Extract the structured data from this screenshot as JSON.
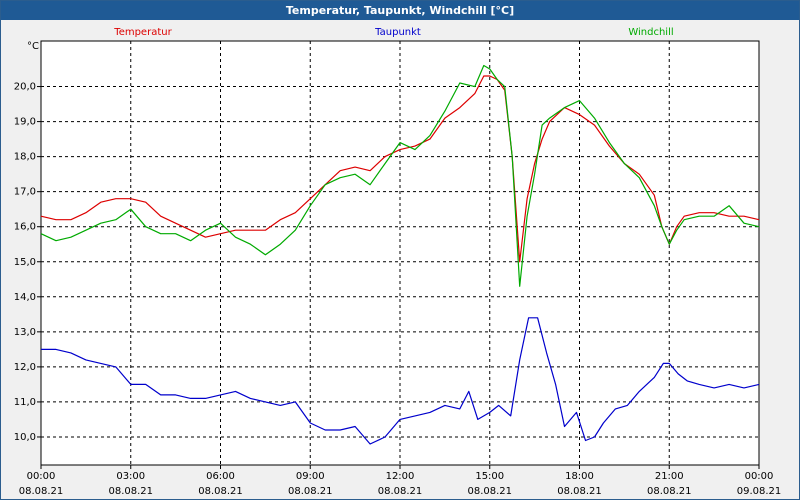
{
  "window": {
    "title": "Temperatur, Taupunkt, Windchill [°C]"
  },
  "chart_data": {
    "type": "line",
    "title": "Temperatur, Taupunkt, Windchill [°C]",
    "ylabel": "°C",
    "ylim": [
      9.2,
      21.3
    ],
    "yticks": [
      10.0,
      11.0,
      12.0,
      13.0,
      14.0,
      15.0,
      16.0,
      17.0,
      18.0,
      19.0,
      20.0
    ],
    "ytick_labels": [
      "10,0",
      "11,0",
      "12,0",
      "13,0",
      "14,0",
      "15,0",
      "16,0",
      "17,0",
      "18,0",
      "19,0",
      "20,0"
    ],
    "xlim": [
      0,
      24
    ],
    "xticks": [
      0,
      3,
      6,
      9,
      12,
      15,
      18,
      21,
      24
    ],
    "xtick_labels": [
      [
        "00:00",
        "08.08.21"
      ],
      [
        "03:00",
        "08.08.21"
      ],
      [
        "06:00",
        "08.08.21"
      ],
      [
        "09:00",
        "08.08.21"
      ],
      [
        "12:00",
        "08.08.21"
      ],
      [
        "15:00",
        "08.08.21"
      ],
      [
        "18:00",
        "08.08.21"
      ],
      [
        "21:00",
        "08.08.21"
      ],
      [
        "00:00",
        "09.08.21"
      ]
    ],
    "grid": true,
    "series": [
      {
        "name": "Temperatur",
        "color": "#dd0000",
        "x": [
          0,
          0.5,
          1,
          1.5,
          2,
          2.5,
          3,
          3.5,
          4,
          4.5,
          5,
          5.5,
          6,
          6.5,
          7,
          7.5,
          8,
          8.5,
          9,
          9.5,
          10,
          10.5,
          11,
          11.5,
          12,
          12.5,
          13,
          13.5,
          14,
          14.5,
          14.8,
          15,
          15.25,
          15.5,
          15.75,
          16,
          16.25,
          16.5,
          16.75,
          17,
          17.5,
          18,
          18.5,
          19,
          19.5,
          20,
          20.5,
          20.75,
          21,
          21.25,
          21.5,
          22,
          22.5,
          23,
          23.5,
          24
        ],
        "values": [
          16.3,
          16.2,
          16.2,
          16.4,
          16.7,
          16.8,
          16.8,
          16.7,
          16.3,
          16.1,
          15.9,
          15.7,
          15.8,
          15.9,
          15.9,
          15.9,
          16.2,
          16.4,
          16.8,
          17.2,
          17.6,
          17.7,
          17.6,
          18.0,
          18.2,
          18.3,
          18.5,
          19.1,
          19.4,
          19.8,
          20.3,
          20.3,
          20.2,
          19.9,
          18.0,
          15.0,
          16.8,
          17.8,
          18.5,
          19.0,
          19.4,
          19.2,
          18.9,
          18.3,
          17.8,
          17.5,
          16.9,
          16.0,
          15.5,
          16.0,
          16.3,
          16.4,
          16.4,
          16.3,
          16.3,
          16.2
        ]
      },
      {
        "name": "Taupunkt",
        "color": "#0000cc",
        "x": [
          0,
          0.5,
          1,
          1.5,
          2,
          2.5,
          3,
          3.5,
          4,
          4.5,
          5,
          5.5,
          6,
          6.5,
          7,
          7.5,
          8,
          8.5,
          9,
          9.5,
          10,
          10.5,
          11,
          11.5,
          12,
          12.5,
          13,
          13.5,
          14,
          14.3,
          14.6,
          15,
          15.3,
          15.7,
          16,
          16.3,
          16.6,
          16.9,
          17.2,
          17.5,
          17.9,
          18.2,
          18.5,
          18.8,
          19.2,
          19.6,
          20,
          20.5,
          20.8,
          21,
          21.3,
          21.6,
          22,
          22.5,
          23,
          23.5,
          24
        ],
        "values": [
          12.5,
          12.5,
          12.4,
          12.2,
          12.1,
          12.0,
          11.5,
          11.5,
          11.2,
          11.2,
          11.1,
          11.1,
          11.2,
          11.3,
          11.1,
          11.0,
          10.9,
          11.0,
          10.4,
          10.2,
          10.2,
          10.3,
          9.8,
          10.0,
          10.5,
          10.6,
          10.7,
          10.9,
          10.8,
          11.3,
          10.5,
          10.7,
          10.9,
          10.6,
          12.2,
          13.4,
          13.4,
          12.4,
          11.5,
          10.3,
          10.7,
          9.9,
          10.0,
          10.4,
          10.8,
          10.9,
          11.3,
          11.7,
          12.1,
          12.1,
          11.8,
          11.6,
          11.5,
          11.4,
          11.5,
          11.4,
          11.5
        ]
      },
      {
        "name": "Windchill",
        "color": "#00aa00",
        "x": [
          0,
          0.5,
          1,
          1.5,
          2,
          2.5,
          3,
          3.5,
          4,
          4.5,
          5,
          5.5,
          6,
          6.5,
          7,
          7.5,
          8,
          8.5,
          9,
          9.5,
          10,
          10.5,
          11,
          11.5,
          12,
          12.5,
          13,
          13.5,
          14,
          14.5,
          14.8,
          15,
          15.25,
          15.5,
          15.75,
          16,
          16.25,
          16.5,
          16.75,
          17,
          17.5,
          18,
          18.5,
          19,
          19.5,
          20,
          20.5,
          20.75,
          21,
          21.25,
          21.5,
          22,
          22.5,
          23,
          23.5,
          24
        ],
        "values": [
          15.8,
          15.6,
          15.7,
          15.9,
          16.1,
          16.2,
          16.5,
          16.0,
          15.8,
          15.8,
          15.6,
          15.9,
          16.1,
          15.7,
          15.5,
          15.2,
          15.5,
          15.9,
          16.6,
          17.2,
          17.4,
          17.5,
          17.2,
          17.8,
          18.4,
          18.2,
          18.6,
          19.3,
          20.1,
          20.0,
          20.6,
          20.5,
          20.2,
          20.0,
          18.0,
          14.3,
          16.3,
          17.5,
          18.9,
          19.1,
          19.4,
          19.6,
          19.1,
          18.4,
          17.8,
          17.4,
          16.6,
          16.0,
          15.5,
          15.9,
          16.2,
          16.3,
          16.3,
          16.6,
          16.1,
          16.0
        ]
      }
    ]
  }
}
